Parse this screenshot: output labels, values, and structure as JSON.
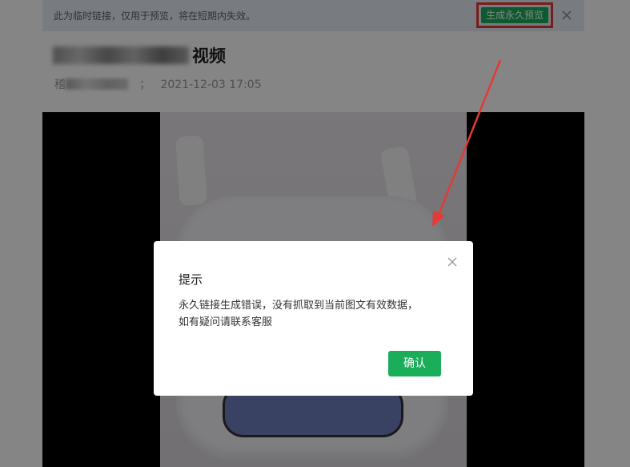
{
  "notice": {
    "text": "此为临时链接，仅用于预览，将在短期内失效。",
    "permanent_button": "生成永久预览",
    "close_icon": "close-icon"
  },
  "article": {
    "title_visible": "视频",
    "author_visible": "稽",
    "author_tail": "；",
    "timestamp": "2021-12-03 17:05"
  },
  "dialog": {
    "title": "提示",
    "message_line1": "永久链接生成错误，没有抓取到当前图文有效数据，",
    "message_line2": "如有疑问请联系客服",
    "confirm_button": "确认",
    "close_icon": "close-icon"
  },
  "colors": {
    "accent_green": "#1aad5a",
    "highlight_red": "#e53935"
  }
}
